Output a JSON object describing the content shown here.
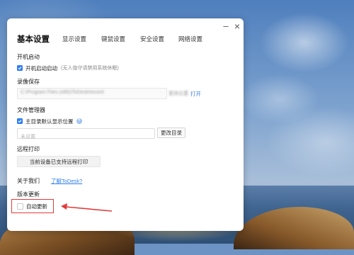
{
  "window": {
    "minimize_label": "–",
    "close_label": "×"
  },
  "tabs": [
    {
      "label": "基本设置",
      "active": true
    },
    {
      "label": "显示设置",
      "active": false
    },
    {
      "label": "键鼠设置",
      "active": false
    },
    {
      "label": "安全设置",
      "active": false
    },
    {
      "label": "网络设置",
      "active": false
    }
  ],
  "startup": {
    "title": "开机启动",
    "auto_start_label": "开机启动启动",
    "auto_start_checked": true,
    "auto_start_hint": "(无人值守请禁用系统休眠)"
  },
  "recording": {
    "title": "录像保存",
    "path_value": "C:\\Program Files (x86)\\ToDesk\\record",
    "change_label": "更改位置",
    "open_label": "打开"
  },
  "file_manager": {
    "title": "文件管理器",
    "default_dir_label": "主目录默认显示位置",
    "default_dir_checked": true,
    "dir_placeholder": "未设置",
    "change_dir_button": "更改目录"
  },
  "remote_print": {
    "title": "远程打印",
    "status_button": "当前设备已支持远程打印"
  },
  "about": {
    "title": "关于我们",
    "link": "了解ToDesk?"
  },
  "update": {
    "title": "版本更新",
    "auto_update_label": "自动更新",
    "auto_update_checked": false
  },
  "colors": {
    "accent": "#2f7ef0",
    "highlight_red": "#e23b3b"
  },
  "icons": {
    "info": "question-circle-icon",
    "check": "checkmark-icon"
  }
}
